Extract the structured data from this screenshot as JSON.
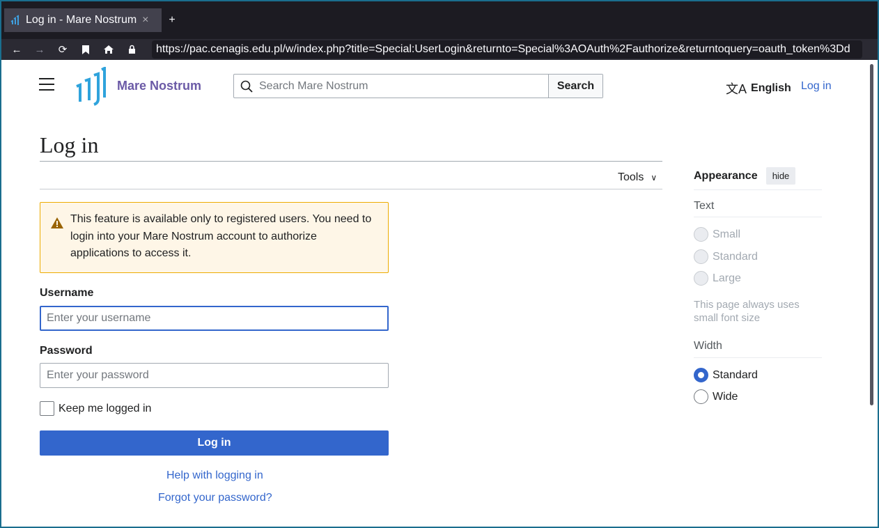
{
  "browser": {
    "tab_title": "Log in - Mare Nostrum",
    "tab_close": "×",
    "new_tab": "+",
    "url": "https://pac.cenagis.edu.pl/w/index.php?title=Special:UserLogin&returnto=Special%3AOAuth%2Fauthorize&returntoquery=oauth_token%3Dd"
  },
  "header": {
    "site_name": "Mare Nostrum",
    "search_placeholder": "Search Mare Nostrum",
    "search_button": "Search",
    "language": "English",
    "login_link": "Log in"
  },
  "main": {
    "title": "Log in",
    "tools": "Tools",
    "warning_text": "This feature is available only to registered users. You need to login into your Mare Nostrum account to authorize applications to access it.",
    "username_label": "Username",
    "username_placeholder": "Enter your username",
    "password_label": "Password",
    "password_placeholder": "Enter your password",
    "keep_logged_in": "Keep me logged in",
    "login_button": "Log in",
    "help_link": "Help with logging in",
    "forgot_link": "Forgot your password?"
  },
  "appearance": {
    "title": "Appearance",
    "hide": "hide",
    "text_heading": "Text",
    "text_options": [
      "Small",
      "Standard",
      "Large"
    ],
    "text_note": "This page always uses small font size",
    "width_heading": "Width",
    "width_options": [
      "Standard",
      "Wide"
    ],
    "width_selected": "Standard"
  },
  "colors": {
    "accent": "#3366cc",
    "site_name": "#6b5aa6",
    "logo": "#36c"
  }
}
